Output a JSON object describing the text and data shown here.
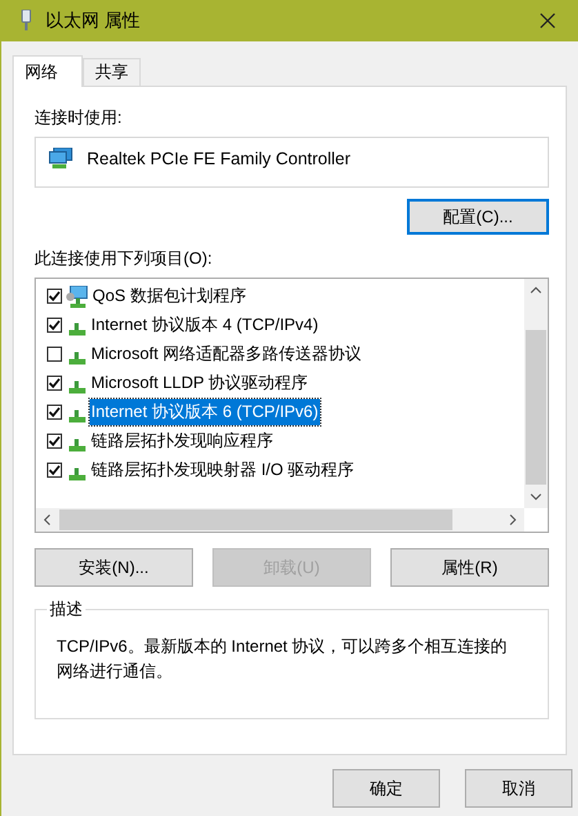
{
  "window": {
    "title": "以太网 属性"
  },
  "tabs": [
    {
      "label": "网络",
      "selected": true
    },
    {
      "label": "共享",
      "selected": false
    }
  ],
  "connect_using": {
    "label": "连接时使用:",
    "adapter": "Realtek PCIe FE Family Controller",
    "configure_button": "配置(C)..."
  },
  "items_label": "此连接使用下列项目(O):",
  "items": [
    {
      "kind": "scheduler",
      "label": "QoS 数据包计划程序",
      "checked": true,
      "selected": false
    },
    {
      "kind": "protocol",
      "label": "Internet 协议版本 4 (TCP/IPv4)",
      "checked": true,
      "selected": false
    },
    {
      "kind": "protocol",
      "label": "Microsoft 网络适配器多路传送器协议",
      "checked": false,
      "selected": false
    },
    {
      "kind": "protocol",
      "label": "Microsoft LLDP 协议驱动程序",
      "checked": true,
      "selected": false
    },
    {
      "kind": "protocol",
      "label": "Internet 协议版本 6 (TCP/IPv6)",
      "checked": true,
      "selected": true
    },
    {
      "kind": "protocol",
      "label": "链路层拓扑发现响应程序",
      "checked": true,
      "selected": false
    },
    {
      "kind": "protocol",
      "label": "链路层拓扑发现映射器 I/O 驱动程序",
      "checked": true,
      "selected": false
    }
  ],
  "item_buttons": [
    {
      "label": "安装(N)...",
      "disabled": false
    },
    {
      "label": "卸载(U)",
      "disabled": true
    },
    {
      "label": "属性(R)",
      "disabled": false
    }
  ],
  "description": {
    "title": "描述",
    "text": "TCP/IPv6。最新版本的 Internet 协议，可以跨多个相互连接的网络进行通信。"
  },
  "dialog_buttons": [
    "确定",
    "取消"
  ]
}
